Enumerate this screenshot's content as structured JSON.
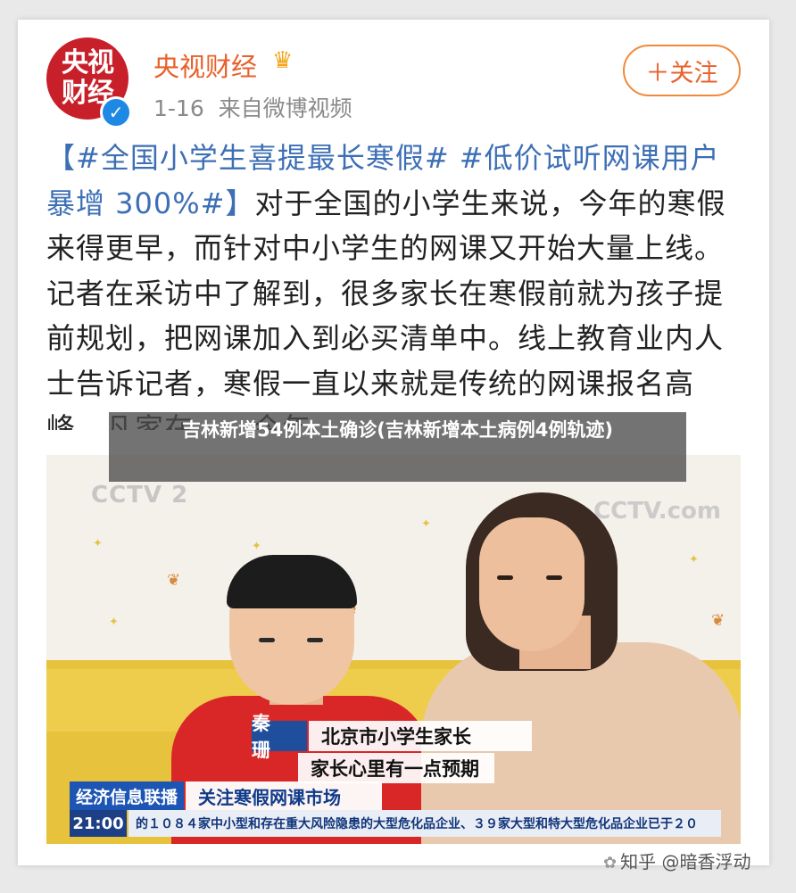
{
  "header": {
    "avatar_text": "央视财经",
    "verified_mark": "✓",
    "account_name": "央视财经",
    "crown_icon": "crown-icon",
    "meta": "1-16  来自微博视频",
    "follow_label": "＋关注"
  },
  "post": {
    "tag_text": "【#全国小学生喜提最长寒假# #低价试听网课用户暴增 300%#】",
    "body_text": "对于全国的小学生来说，今年的寒假来得更早，而针对中小学生的网课又开始大量上线。记者在采访中了解到，很多家长在寒假前就为孩子提前规划，把网课加入到必买清单中。线上教育业内人士告诉记者，寒假一直以来就是传统的网课报名高峰，凡家在……今年"
  },
  "banner": {
    "text": "吉林新增54例本土确诊(吉林新增本土病例4例轨迹)"
  },
  "video": {
    "logo_left": "CCTV 2",
    "logo_right": "CCTV.com",
    "caption_name": "秦 珊",
    "caption_title": "北京市小学生家长",
    "caption_quote": "家长心里有一点预期",
    "program_name": "经济信息联播",
    "program_topic": "关注寒假网课市场",
    "clock": "21:00",
    "ticker": "的１０８４家中小型和存在重大风险隐患的大型危化品企业、３９家大型和特大型危化品企业已于２０"
  },
  "watermark": {
    "text": "知乎 @暗香浮动",
    "icon": "wechat-icon"
  },
  "colors": {
    "brand_red": "#c8202a",
    "name_orange": "#e8602a",
    "tag_blue": "#3d6fb5",
    "cctv_blue": "#1d55b5"
  }
}
